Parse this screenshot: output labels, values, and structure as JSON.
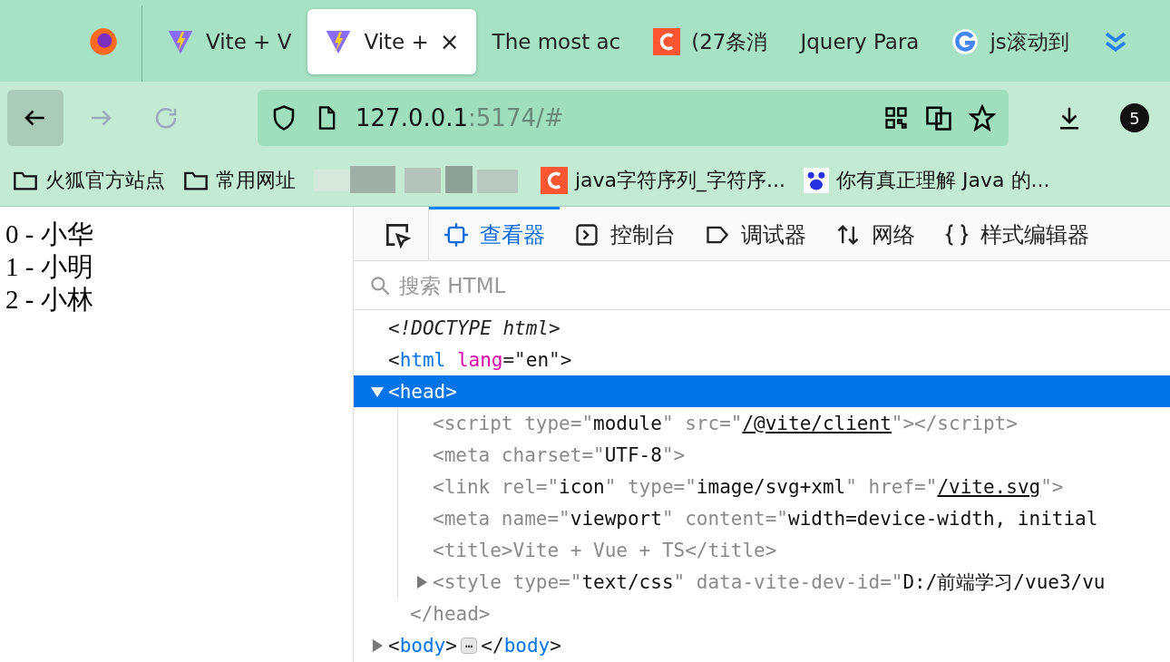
{
  "tabs": [
    {
      "kind": "browser",
      "selected": false
    },
    {
      "kind": "vite",
      "label": "Vite + V",
      "selected": false
    },
    {
      "kind": "vite",
      "label": "Vite +",
      "selected": true,
      "close": "×"
    },
    {
      "kind": "none",
      "label": "The most ac",
      "selected": false
    },
    {
      "kind": "csdn",
      "label": "(27条消",
      "selected": false
    },
    {
      "kind": "none",
      "label": "Jquery Para",
      "selected": false
    },
    {
      "kind": "google",
      "label": "js滚动到",
      "selected": false
    },
    {
      "kind": "chevrons",
      "selected": false
    }
  ],
  "address": {
    "host": "127.0.0.1",
    "rest": ":5174/#"
  },
  "downloads_badge": "5",
  "bookmarks": [
    {
      "kind": "folder",
      "label": "火狐官方站点"
    },
    {
      "kind": "folder",
      "label": "常用网址"
    },
    {
      "kind": "blurred"
    },
    {
      "kind": "csdn",
      "label": "java字符序列_字符序..."
    },
    {
      "kind": "paw",
      "label": "你有真正理解 Java 的..."
    }
  ],
  "page_lines": [
    "0 - 小华",
    "1 - 小明",
    "2 - 小林"
  ],
  "devtools": {
    "tools": [
      {
        "kind": "inspector",
        "label": "查看器",
        "selected": true
      },
      {
        "kind": "console",
        "label": "控制台",
        "selected": false
      },
      {
        "kind": "debugger",
        "label": "调试器",
        "selected": false
      },
      {
        "kind": "network",
        "label": "网络",
        "selected": false
      },
      {
        "kind": "style",
        "label": "样式编辑器",
        "selected": false
      }
    ],
    "search": {
      "placeholder": "搜索 HTML"
    },
    "tree": [
      {
        "tokens": [
          {
            "kind": "doctype",
            "t": "<!DOCTYPE html>"
          }
        ],
        "selected": false
      },
      {
        "tokens": [
          {
            "kind": "punct",
            "t": "<"
          },
          {
            "kind": "tag",
            "t": "html"
          },
          {
            "kind": "attr",
            "t": " lang"
          },
          {
            "kind": "punct",
            "t": "=\""
          },
          {
            "kind": "value",
            "t": "en"
          },
          {
            "kind": "punct",
            "t": "\">"
          }
        ],
        "selected": false,
        "children": [
          {
            "tokens": [
              {
                "kind": "punct",
                "t": "<"
              },
              {
                "kind": "tag",
                "t": "head"
              },
              {
                "kind": "punct",
                "t": ">"
              }
            ],
            "selected": true,
            "expanded": true,
            "closing": "</head>",
            "children": [
              {
                "dim": true,
                "selected": false,
                "tokens": [
                  {
                    "kind": "punct",
                    "t": "<script"
                  },
                  {
                    "kind": "attr",
                    "t": " type"
                  },
                  {
                    "kind": "punct",
                    "t": "=\""
                  },
                  {
                    "kind": "value",
                    "t": "module"
                  },
                  {
                    "kind": "punct",
                    "t": "\""
                  },
                  {
                    "kind": "attr",
                    "t": " src"
                  },
                  {
                    "kind": "punct",
                    "t": "=\""
                  },
                  {
                    "kind": "link",
                    "t": "/@vite/client"
                  },
                  {
                    "kind": "punct",
                    "t": "\"></script>"
                  }
                ]
              },
              {
                "dim": true,
                "selected": false,
                "tokens": [
                  {
                    "kind": "punct",
                    "t": "<meta"
                  },
                  {
                    "kind": "attr",
                    "t": " charset"
                  },
                  {
                    "kind": "punct",
                    "t": "=\""
                  },
                  {
                    "kind": "value",
                    "t": "UTF-8"
                  },
                  {
                    "kind": "punct",
                    "t": "\">"
                  }
                ]
              },
              {
                "dim": true,
                "selected": false,
                "tokens": [
                  {
                    "kind": "punct",
                    "t": "<link"
                  },
                  {
                    "kind": "attr",
                    "t": " rel"
                  },
                  {
                    "kind": "punct",
                    "t": "=\""
                  },
                  {
                    "kind": "value",
                    "t": "icon"
                  },
                  {
                    "kind": "punct",
                    "t": "\""
                  },
                  {
                    "kind": "attr",
                    "t": " type"
                  },
                  {
                    "kind": "punct",
                    "t": "=\""
                  },
                  {
                    "kind": "value",
                    "t": "image/svg+xml"
                  },
                  {
                    "kind": "punct",
                    "t": "\""
                  },
                  {
                    "kind": "attr",
                    "t": " href"
                  },
                  {
                    "kind": "punct",
                    "t": "=\""
                  },
                  {
                    "kind": "link",
                    "t": "/vite.svg"
                  },
                  {
                    "kind": "punct",
                    "t": "\">"
                  }
                ]
              },
              {
                "dim": true,
                "selected": false,
                "tokens": [
                  {
                    "kind": "punct",
                    "t": "<meta"
                  },
                  {
                    "kind": "attr",
                    "t": " name"
                  },
                  {
                    "kind": "punct",
                    "t": "=\""
                  },
                  {
                    "kind": "value",
                    "t": "viewport"
                  },
                  {
                    "kind": "punct",
                    "t": "\""
                  },
                  {
                    "kind": "attr",
                    "t": " content"
                  },
                  {
                    "kind": "punct",
                    "t": "=\""
                  },
                  {
                    "kind": "value",
                    "t": "width=device-width, initial"
                  }
                ]
              },
              {
                "dim": true,
                "selected": false,
                "tokens": [
                  {
                    "kind": "punct",
                    "t": "<title>"
                  },
                  {
                    "kind": "attr",
                    "t": "Vite + Vue + TS"
                  },
                  {
                    "kind": "punct",
                    "t": "</title>"
                  }
                ]
              },
              {
                "dim": true,
                "selected": false,
                "expanded": false,
                "tokens": [
                  {
                    "kind": "punct",
                    "t": "<style"
                  },
                  {
                    "kind": "attr",
                    "t": " type"
                  },
                  {
                    "kind": "punct",
                    "t": "=\""
                  },
                  {
                    "kind": "value",
                    "t": "text/css"
                  },
                  {
                    "kind": "punct",
                    "t": "\""
                  },
                  {
                    "kind": "attr",
                    "t": " data-vite-dev-id"
                  },
                  {
                    "kind": "punct",
                    "t": "=\""
                  },
                  {
                    "kind": "value",
                    "t": "D:/前端学习/vue3/vu"
                  }
                ]
              }
            ]
          },
          {
            "tokens": [
              {
                "kind": "punct",
                "t": "<"
              },
              {
                "kind": "tag",
                "t": "body"
              },
              {
                "kind": "punct",
                "t": ">"
              },
              {
                "kind": "badge",
                "t": "⋯"
              },
              {
                "kind": "punct",
                "t": "</"
              },
              {
                "kind": "tag",
                "t": "body"
              },
              {
                "kind": "punct",
                "t": ">"
              }
            ],
            "selected": false,
            "expanded": false
          }
        ]
      }
    ]
  }
}
